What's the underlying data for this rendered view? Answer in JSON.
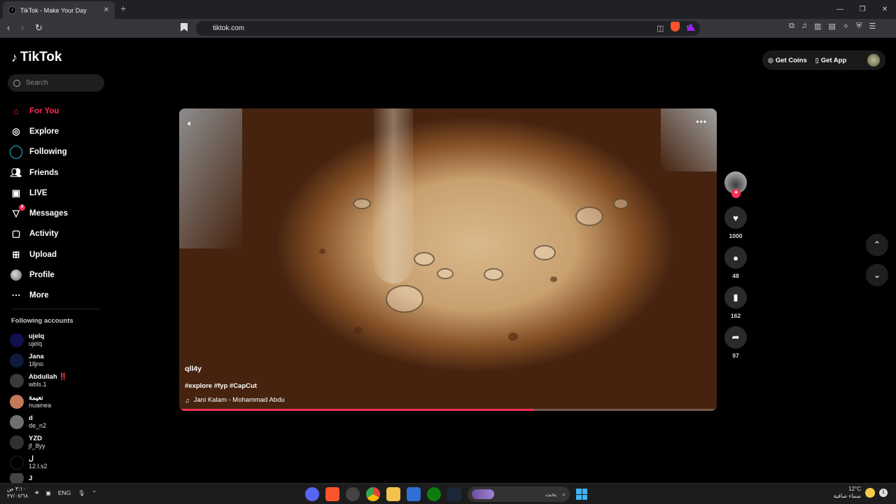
{
  "browser": {
    "tab_title": "TikTok - Make Your Day",
    "tab_close": "✕",
    "new_tab": "+",
    "url": "tiktok.com",
    "window_controls": [
      "—",
      "❐",
      "✕"
    ]
  },
  "brand": {
    "name": "TikTok",
    "icon": "tiktok-note-icon"
  },
  "search": {
    "placeholder": "Search"
  },
  "nav": [
    {
      "label": "For You",
      "icon": "home-icon",
      "active": true
    },
    {
      "label": "Explore",
      "icon": "compass-icon"
    },
    {
      "label": "Following",
      "icon": "following-ring-icon"
    },
    {
      "label": "Friends",
      "icon": "friends-icon"
    },
    {
      "label": "LIVE",
      "icon": "live-icon"
    },
    {
      "label": "Messages",
      "icon": "messages-icon",
      "badge": "9"
    },
    {
      "label": "Activity",
      "icon": "activity-icon"
    },
    {
      "label": "Upload",
      "icon": "upload-icon"
    },
    {
      "label": "Profile",
      "icon": "profile-avatar"
    },
    {
      "label": "More",
      "icon": "more-icon"
    }
  ],
  "following_accounts": {
    "title": "Following accounts",
    "items": [
      {
        "name": "ujelq",
        "handle": "ujelq",
        "color": "#10104a"
      },
      {
        "name": "Jana",
        "handle": "1lljno",
        "color": "#0f1b3d"
      },
      {
        "name": "Abdullah ‼️",
        "handle": "wbls.1",
        "color": "#3a3a3a"
      },
      {
        "name": "نعيمة",
        "handle": "nuainea",
        "color": "#c27a5a"
      },
      {
        "name": "d",
        "handle": "de_n2",
        "color": "#707070"
      },
      {
        "name": "YZD",
        "handle": "jf_8yy",
        "color": "#303030"
      },
      {
        "name": "ل",
        "handle": "12.l.s2",
        "color": "#000000"
      },
      {
        "name": "J",
        "handle": "",
        "color": "#444444"
      }
    ]
  },
  "header_actions": {
    "get_coins": "Get Coins",
    "get_app": "Get App"
  },
  "video": {
    "author": "qll4y",
    "tags": "#explore #fyp #CapCut",
    "music": "Jani Kalam - Mohammad Abdu",
    "progress": 0.66
  },
  "actions": {
    "likes": "1000",
    "comments": "48",
    "saves": "162",
    "shares": "97"
  },
  "taskbar": {
    "clock_time": "٣:١٠ ص",
    "clock_date": "٢٧/٠٧/٦٨",
    "language": "ENG",
    "search_text": "بحث",
    "temperature": "12°C",
    "weather": "سماء صافية",
    "notification_count": "1"
  },
  "colors": {
    "accent": "#fe2c55",
    "following_ring": "#25c3e6"
  }
}
